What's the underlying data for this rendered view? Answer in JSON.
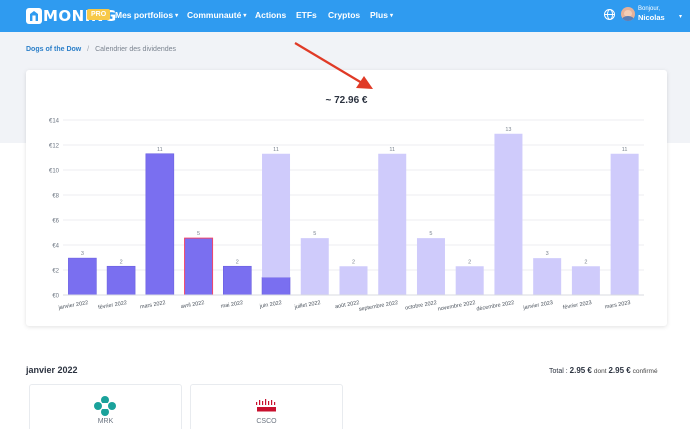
{
  "nav": {
    "brand": "MONING",
    "pro_badge": "PRO",
    "items": [
      "Mes portfolios",
      "Communauté",
      "Actions",
      "ETFs",
      "Cryptos",
      "Plus"
    ],
    "user_greeting": "Bonjour,",
    "user_name": "Nicolas",
    "icons": [
      "globe-icon",
      "avatar",
      "chevron-down-icon"
    ]
  },
  "breadcrumb": {
    "parent": "Dogs of the Dow",
    "current": "Calendrier des dividendes"
  },
  "dividend_chart": {
    "total_label": "~ 72.96 €"
  },
  "chart_data": {
    "type": "bar",
    "stacked": true,
    "categories": [
      "janvier 2022",
      "février 2022",
      "mars 2022",
      "avril 2022",
      "mai 2022",
      "juin 2022",
      "juillet 2022",
      "août 2022",
      "septembre 2022",
      "octobre 2022",
      "novembre 2022",
      "décembre 2022",
      "janvier 2023",
      "février 2023",
      "mars 2023"
    ],
    "series": [
      {
        "color": "#7a6ff0",
        "values": [
          2.95,
          2.3,
          11.3,
          4.55,
          2.3,
          1.4,
          0,
          0,
          0,
          0,
          0,
          0,
          0,
          0,
          0
        ]
      },
      {
        "color": "#cfcbfb",
        "values": [
          0,
          0,
          0,
          0,
          0,
          9.9,
          4.55,
          2.3,
          11.3,
          4.55,
          2.3,
          12.9,
          2.95,
          2.3,
          11.3
        ]
      }
    ],
    "data_labels": [
      "3",
      "2",
      "11",
      "5",
      "2",
      "11",
      "5",
      "2",
      "11",
      "5",
      "2",
      "13",
      "3",
      "2",
      "11"
    ],
    "y_ticks": [
      "€0",
      "€2",
      "€4",
      "€6",
      "€8",
      "€10",
      "€12",
      "€14"
    ],
    "ylim": [
      0,
      14
    ],
    "grid": true,
    "highlight_index": 3,
    "highlight_color": "#f0456b"
  },
  "annotation": {
    "arrow_color": "#e03a26"
  },
  "month_detail": {
    "title": "janvier 2022",
    "summary_prefix": "Total :",
    "total": "2.95 €",
    "dont": "dont",
    "confirmed": "2.95 €",
    "confirmed_label": "confirmé",
    "stocks": [
      "MRK",
      "CSCO"
    ]
  },
  "colors": {
    "nav": "#2f9bf0",
    "pro": "#f7c948",
    "paid": "#7a6ff0",
    "projected": "#cfcbfb",
    "merck_teal": "#1aa29b",
    "cisco_red": "#c8102e"
  }
}
